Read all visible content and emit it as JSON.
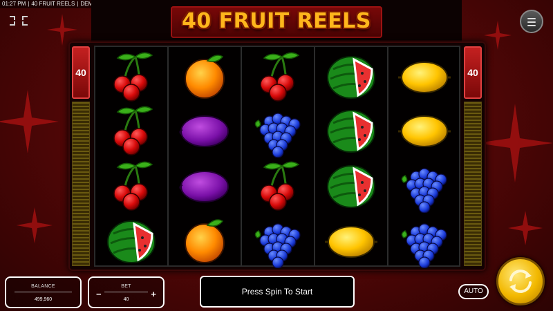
{
  "topbar": {
    "time": "01:27 PM",
    "sep1": "|",
    "game_name": "40 FRUIT REELS",
    "sep2": "|",
    "mode": "DEMO"
  },
  "logo": {
    "text": "40 FRUIT REELS"
  },
  "icons": {
    "expand": "expand-arrows-icon",
    "menu": "hamburger-menu-icon",
    "spin": "spin-arrows-icon"
  },
  "paylines": {
    "left": "40",
    "right": "40"
  },
  "reels": [
    [
      "cherries",
      "cherries",
      "cherries",
      "watermelon"
    ],
    [
      "orange",
      "plum",
      "plum",
      "orange"
    ],
    [
      "cherries",
      "grapes",
      "cherries",
      "grapes"
    ],
    [
      "watermelon",
      "watermelon",
      "watermelon",
      "lemon"
    ],
    [
      "lemon",
      "lemon",
      "grapes",
      "grapes"
    ]
  ],
  "balance": {
    "label": "BALANCE",
    "value": "499,960"
  },
  "bet": {
    "label": "BET",
    "value": "40",
    "minus": "−",
    "plus": "+"
  },
  "message": "Press Spin To Start",
  "auto_label": "AUTO",
  "colors": {
    "background": "#5a0808",
    "logo_text": "#ffb61c",
    "spin_button": "#f2b800",
    "payline_badge": "#c42020"
  }
}
